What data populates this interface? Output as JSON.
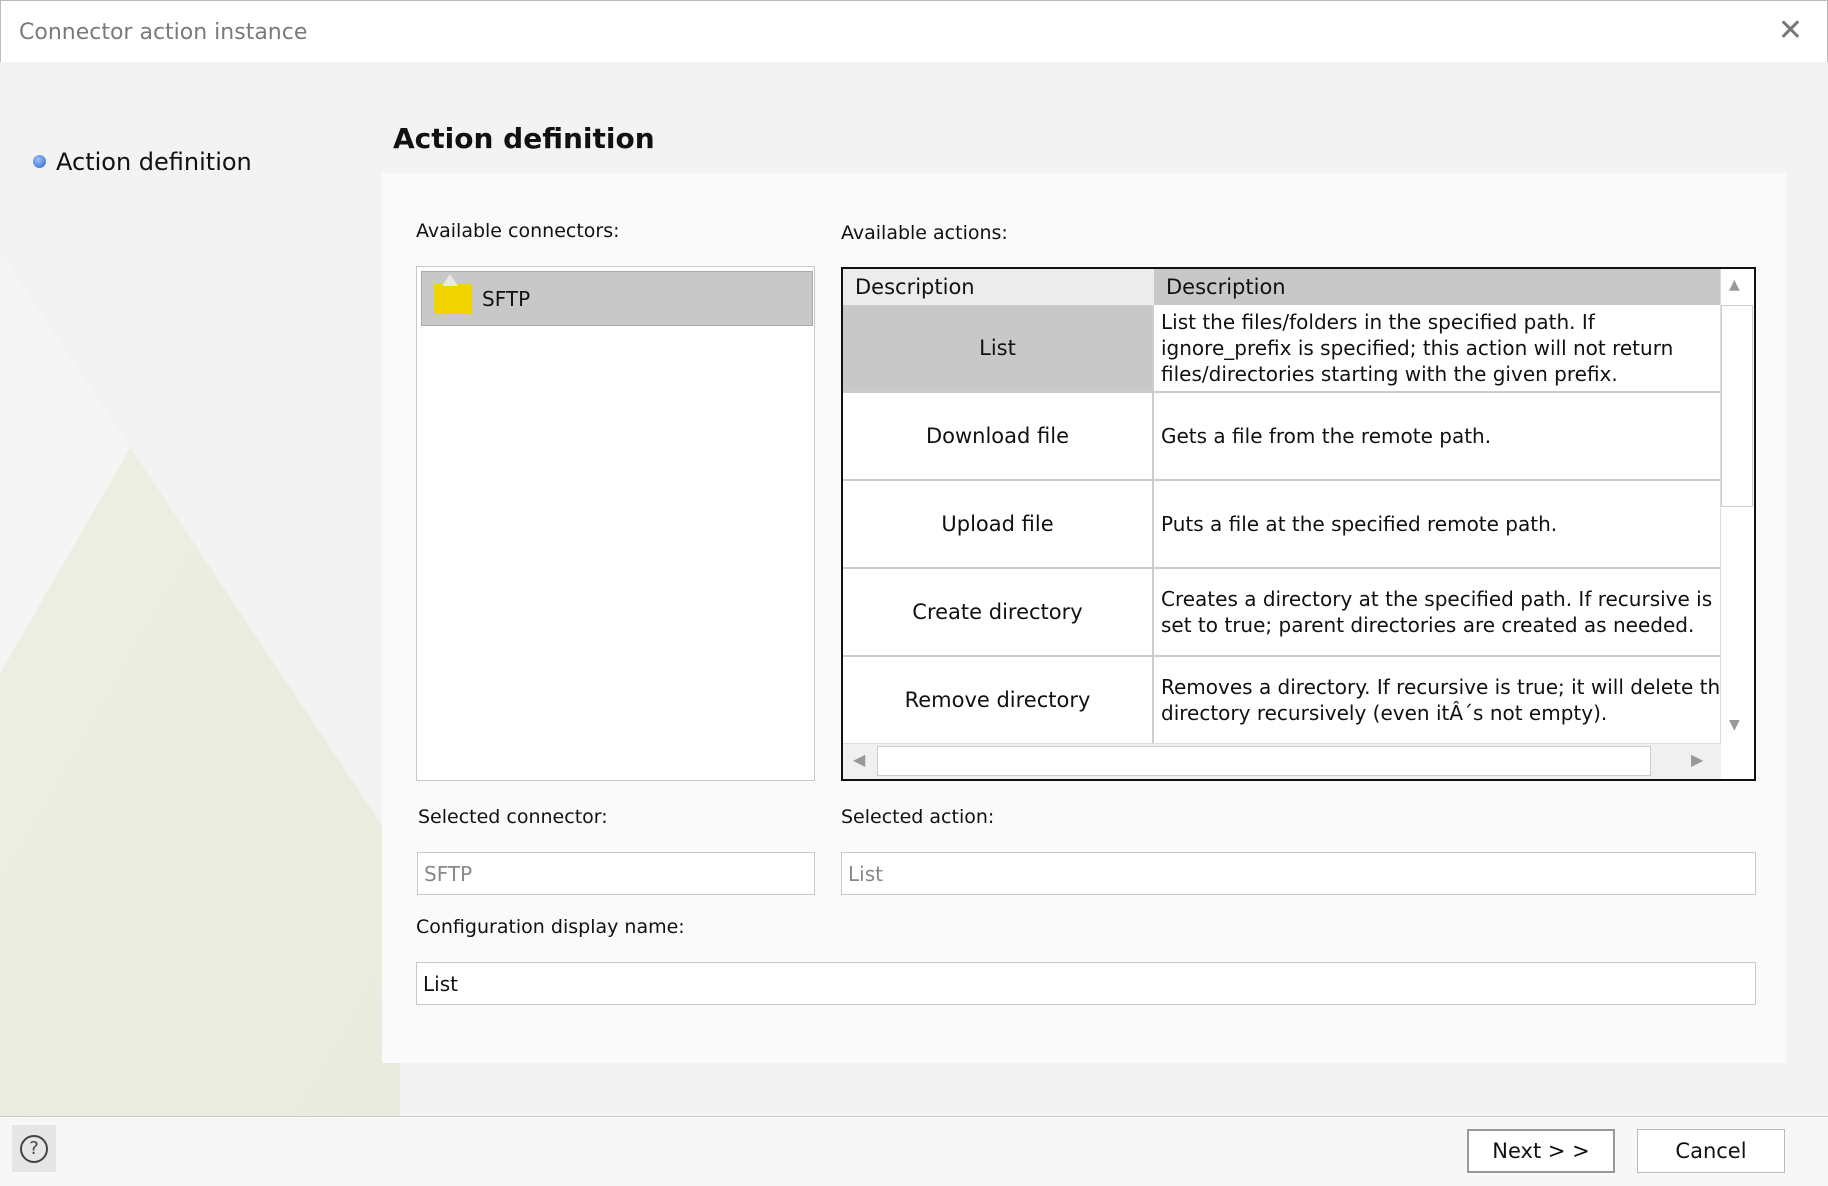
{
  "window": {
    "title": "Connector action instance",
    "close_icon": "close-icon"
  },
  "nav": {
    "items": [
      {
        "label": "Action definition",
        "active": true
      }
    ]
  },
  "page": {
    "heading": "Action definition"
  },
  "connectors": {
    "label": "Available connectors:",
    "items": [
      {
        "label": "SFTP",
        "icon": "folder-icon",
        "selected": true
      }
    ]
  },
  "actions": {
    "label": "Available actions:",
    "columns": [
      "Description",
      "Description"
    ],
    "rows": [
      {
        "name": "List",
        "description": "List the files/folders in the specified path. If\nignore_prefix is specified; this action will not return\nfiles/directories starting with the given prefix.",
        "selected": true
      },
      {
        "name": "Download file",
        "description": "Gets a file from the remote path."
      },
      {
        "name": "Upload file",
        "description": "Puts a file at the specified remote path."
      },
      {
        "name": "Create directory",
        "description": "Creates a directory at the specified path. If recursive is\nset to true; parent directories are created as needed."
      },
      {
        "name": "Remove directory",
        "description": "Removes a directory. If recursive is true; it will delete th\ndirectory recursively (even itÂ´s not empty)."
      }
    ]
  },
  "selected_connector": {
    "label": "Selected connector:",
    "value": "SFTP"
  },
  "selected_action": {
    "label": "Selected action:",
    "value": "List"
  },
  "config_name": {
    "label": "Configuration display name:",
    "value": "List"
  },
  "footer": {
    "help_icon": "help-icon",
    "next": "Next > >",
    "cancel": "Cancel"
  }
}
